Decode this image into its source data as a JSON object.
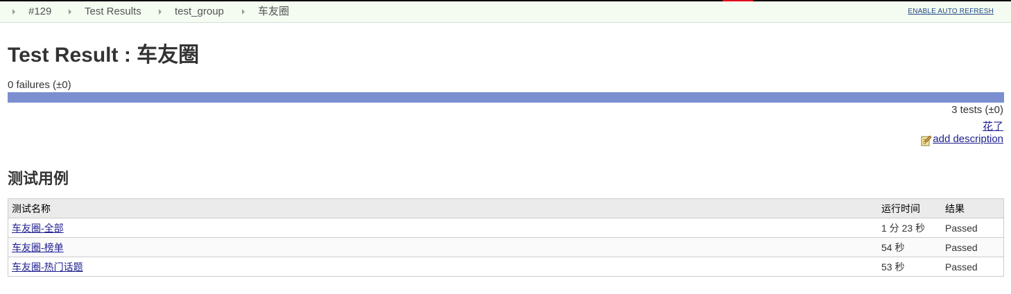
{
  "breadcrumb": {
    "items": [
      {
        "label": "#129"
      },
      {
        "label": "Test Results"
      },
      {
        "label": "test_group"
      },
      {
        "label": "车友圈"
      }
    ],
    "auto_refresh_label": "ENABLE AUTO REFRESH"
  },
  "header": {
    "title": "Test Result : 车友圈"
  },
  "summary": {
    "failures_text": "0 failures (±0)",
    "pass_fraction": 1.0,
    "tests_text": "3 tests (±0)",
    "duration_link": "花了",
    "add_description": "add description"
  },
  "section": {
    "title": "测试用例"
  },
  "table": {
    "columns": [
      "测试名称",
      "运行时间",
      "结果"
    ],
    "rows": [
      {
        "name": "车友圈-全部",
        "duration": "1 分 23 秒",
        "status": "Passed"
      },
      {
        "name": "车友圈-榜单",
        "duration": "54 秒",
        "status": "Passed"
      },
      {
        "name": "车友圈-热门话题",
        "duration": "53 秒",
        "status": "Passed"
      }
    ]
  },
  "colors": {
    "progress_pass": "#7b8fd0",
    "status_passed": "#3a4ba5",
    "link": "#1d1d8f"
  }
}
